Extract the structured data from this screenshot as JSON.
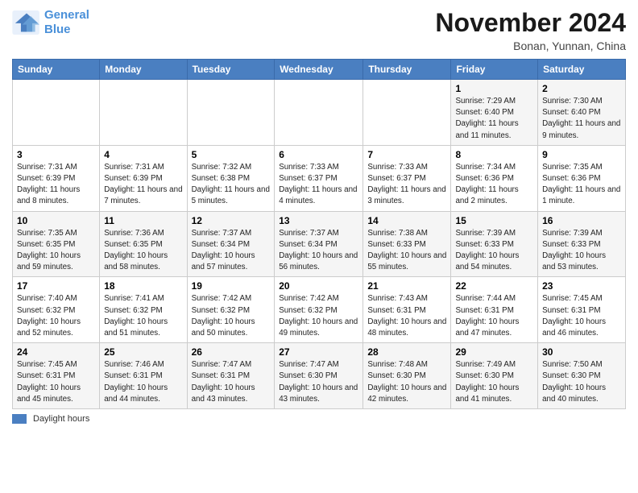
{
  "header": {
    "logo_line1": "General",
    "logo_line2": "Blue",
    "month": "November 2024",
    "location": "Bonan, Yunnan, China"
  },
  "footer": {
    "bar_label": "Daylight hours"
  },
  "weekdays": [
    "Sunday",
    "Monday",
    "Tuesday",
    "Wednesday",
    "Thursday",
    "Friday",
    "Saturday"
  ],
  "weeks": [
    {
      "cells": [
        {
          "day": "",
          "info": ""
        },
        {
          "day": "",
          "info": ""
        },
        {
          "day": "",
          "info": ""
        },
        {
          "day": "",
          "info": ""
        },
        {
          "day": "",
          "info": ""
        },
        {
          "day": "1",
          "info": "Sunrise: 7:29 AM\nSunset: 6:40 PM\nDaylight: 11 hours and 11 minutes."
        },
        {
          "day": "2",
          "info": "Sunrise: 7:30 AM\nSunset: 6:40 PM\nDaylight: 11 hours and 9 minutes."
        }
      ]
    },
    {
      "cells": [
        {
          "day": "3",
          "info": "Sunrise: 7:31 AM\nSunset: 6:39 PM\nDaylight: 11 hours and 8 minutes."
        },
        {
          "day": "4",
          "info": "Sunrise: 7:31 AM\nSunset: 6:39 PM\nDaylight: 11 hours and 7 minutes."
        },
        {
          "day": "5",
          "info": "Sunrise: 7:32 AM\nSunset: 6:38 PM\nDaylight: 11 hours and 5 minutes."
        },
        {
          "day": "6",
          "info": "Sunrise: 7:33 AM\nSunset: 6:37 PM\nDaylight: 11 hours and 4 minutes."
        },
        {
          "day": "7",
          "info": "Sunrise: 7:33 AM\nSunset: 6:37 PM\nDaylight: 11 hours and 3 minutes."
        },
        {
          "day": "8",
          "info": "Sunrise: 7:34 AM\nSunset: 6:36 PM\nDaylight: 11 hours and 2 minutes."
        },
        {
          "day": "9",
          "info": "Sunrise: 7:35 AM\nSunset: 6:36 PM\nDaylight: 11 hours and 1 minute."
        }
      ]
    },
    {
      "cells": [
        {
          "day": "10",
          "info": "Sunrise: 7:35 AM\nSunset: 6:35 PM\nDaylight: 10 hours and 59 minutes."
        },
        {
          "day": "11",
          "info": "Sunrise: 7:36 AM\nSunset: 6:35 PM\nDaylight: 10 hours and 58 minutes."
        },
        {
          "day": "12",
          "info": "Sunrise: 7:37 AM\nSunset: 6:34 PM\nDaylight: 10 hours and 57 minutes."
        },
        {
          "day": "13",
          "info": "Sunrise: 7:37 AM\nSunset: 6:34 PM\nDaylight: 10 hours and 56 minutes."
        },
        {
          "day": "14",
          "info": "Sunrise: 7:38 AM\nSunset: 6:33 PM\nDaylight: 10 hours and 55 minutes."
        },
        {
          "day": "15",
          "info": "Sunrise: 7:39 AM\nSunset: 6:33 PM\nDaylight: 10 hours and 54 minutes."
        },
        {
          "day": "16",
          "info": "Sunrise: 7:39 AM\nSunset: 6:33 PM\nDaylight: 10 hours and 53 minutes."
        }
      ]
    },
    {
      "cells": [
        {
          "day": "17",
          "info": "Sunrise: 7:40 AM\nSunset: 6:32 PM\nDaylight: 10 hours and 52 minutes."
        },
        {
          "day": "18",
          "info": "Sunrise: 7:41 AM\nSunset: 6:32 PM\nDaylight: 10 hours and 51 minutes."
        },
        {
          "day": "19",
          "info": "Sunrise: 7:42 AM\nSunset: 6:32 PM\nDaylight: 10 hours and 50 minutes."
        },
        {
          "day": "20",
          "info": "Sunrise: 7:42 AM\nSunset: 6:32 PM\nDaylight: 10 hours and 49 minutes."
        },
        {
          "day": "21",
          "info": "Sunrise: 7:43 AM\nSunset: 6:31 PM\nDaylight: 10 hours and 48 minutes."
        },
        {
          "day": "22",
          "info": "Sunrise: 7:44 AM\nSunset: 6:31 PM\nDaylight: 10 hours and 47 minutes."
        },
        {
          "day": "23",
          "info": "Sunrise: 7:45 AM\nSunset: 6:31 PM\nDaylight: 10 hours and 46 minutes."
        }
      ]
    },
    {
      "cells": [
        {
          "day": "24",
          "info": "Sunrise: 7:45 AM\nSunset: 6:31 PM\nDaylight: 10 hours and 45 minutes."
        },
        {
          "day": "25",
          "info": "Sunrise: 7:46 AM\nSunset: 6:31 PM\nDaylight: 10 hours and 44 minutes."
        },
        {
          "day": "26",
          "info": "Sunrise: 7:47 AM\nSunset: 6:31 PM\nDaylight: 10 hours and 43 minutes."
        },
        {
          "day": "27",
          "info": "Sunrise: 7:47 AM\nSunset: 6:30 PM\nDaylight: 10 hours and 43 minutes."
        },
        {
          "day": "28",
          "info": "Sunrise: 7:48 AM\nSunset: 6:30 PM\nDaylight: 10 hours and 42 minutes."
        },
        {
          "day": "29",
          "info": "Sunrise: 7:49 AM\nSunset: 6:30 PM\nDaylight: 10 hours and 41 minutes."
        },
        {
          "day": "30",
          "info": "Sunrise: 7:50 AM\nSunset: 6:30 PM\nDaylight: 10 hours and 40 minutes."
        }
      ]
    }
  ]
}
